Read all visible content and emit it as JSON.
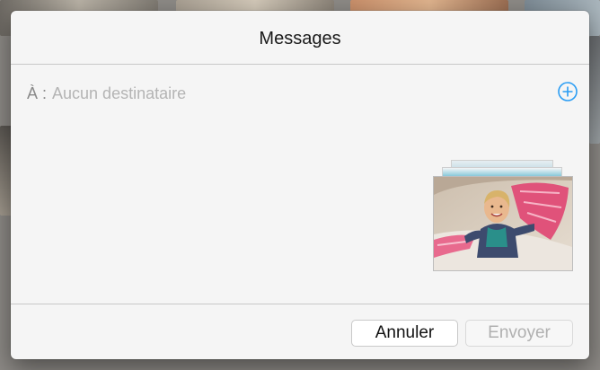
{
  "dialog": {
    "title": "Messages"
  },
  "recipient": {
    "label": "À :",
    "placeholder": "Aucun destinataire"
  },
  "attachment": {
    "description_icon": "photo-thumbnail"
  },
  "buttons": {
    "cancel_label": "Annuler",
    "send_label": "Envoyer"
  },
  "colors": {
    "accent": "#2a9df4",
    "sheet_background": "#f5f5f5",
    "disabled_text": "#b0b0b0"
  },
  "icons": {
    "add_recipient": "plus-circle-icon"
  }
}
